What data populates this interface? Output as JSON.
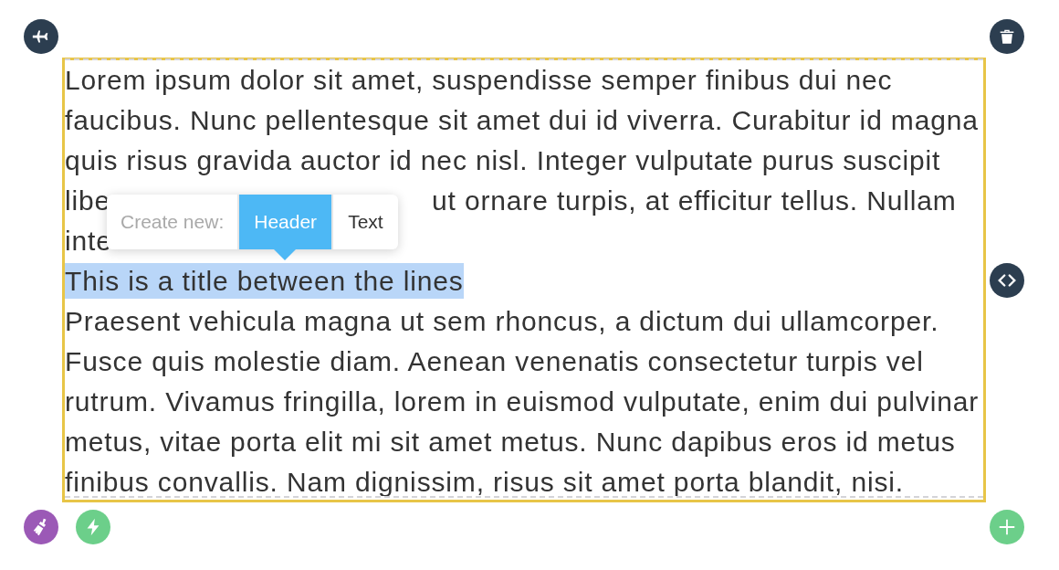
{
  "blocks": [
    {
      "kind": "paragraph",
      "text": "Lorem ipsum dolor sit amet, suspendisse semper finibus dui nec faucibus. Nunc pellentesque sit amet dui id viverra. Curabitur id magna quis risus gravida auctor id nec nisl. Integer vulputate purus suscipit"
    },
    {
      "kind": "line",
      "segments": [
        "libe",
        "ut ornare turpis, at efficitur tellus. Nullam"
      ]
    },
    {
      "kind": "line",
      "segments": [
        "inte"
      ]
    },
    {
      "kind": "title",
      "text": "This is a title between the lines",
      "selected": true
    },
    {
      "kind": "paragraph",
      "text": "Praesent vehicula magna ut sem rhoncus, a dictum dui ullamcorper. Fusce quis molestie diam. Aenean venenatis consectetur turpis vel rutrum. Vivamus fringilla, lorem in euismod vulputate, enim dui pulvinar metus, vitae porta elit mi sit amet metus. Nunc dapibus eros id metus finibus convallis. Nam dignissim, risus sit amet porta blandit, nisi."
    }
  ],
  "popup": {
    "label": "Create new:",
    "options": [
      {
        "label": "Header",
        "selected": true
      },
      {
        "label": "Text",
        "selected": false
      }
    ]
  }
}
